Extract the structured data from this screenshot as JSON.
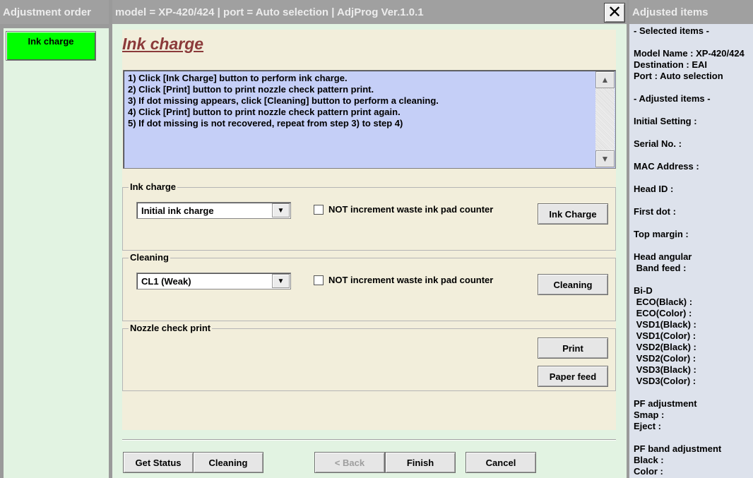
{
  "left_pane": {
    "title": "Adjustment order",
    "items": [
      {
        "label": "Ink charge",
        "active": true,
        "color": "#00ff00"
      }
    ]
  },
  "window": {
    "title": "model = XP-420/424  |  port = Auto selection  |  AdjProg Ver.1.0.1",
    "close_icon": "close-icon",
    "close_glyph": "✕"
  },
  "main": {
    "page_title": "Ink charge",
    "instructions": [
      "1) Click [Ink Charge] button to perform ink charge.",
      "2) Click [Print] button to print nozzle check pattern print.",
      "3) If dot missing appears, click [Cleaning] button to perform a cleaning.",
      "4) Click [Print] button to print nozzle check pattern print again.",
      "5) If dot missing is not recovered, repeat from step 3) to step 4)"
    ],
    "ink_charge": {
      "legend": "Ink charge",
      "dropdown_value": "Initial ink charge",
      "checkbox_label": "NOT increment waste ink pad counter",
      "checkbox_checked": false,
      "button": "Ink Charge"
    },
    "cleaning": {
      "legend": "Cleaning",
      "dropdown_value": "CL1 (Weak)",
      "checkbox_label": "NOT increment waste ink pad counter",
      "checkbox_checked": false,
      "button": "Cleaning"
    },
    "nozzle": {
      "legend": "Nozzle check print",
      "print_button": "Print",
      "paper_feed_button": "Paper feed"
    }
  },
  "bottom_bar": {
    "get_status": "Get Status",
    "cleaning": "Cleaning",
    "back": "< Back",
    "back_disabled": true,
    "finish": "Finish",
    "cancel": "Cancel"
  },
  "right_pane": {
    "title": "Adjusted items",
    "lines": [
      "- Selected items -",
      "",
      "Model Name : XP-420/424",
      "Destination : EAI",
      "Port : Auto selection",
      "",
      "- Adjusted items -",
      "",
      "Initial Setting :",
      "",
      "Serial No. :",
      "",
      "MAC Address :",
      "",
      "Head ID :",
      "",
      "First dot :",
      "",
      "Top margin :",
      "",
      "Head angular",
      " Band feed :",
      "",
      "Bi-D",
      " ECO(Black)  :",
      " ECO(Color)  :",
      " VSD1(Black) :",
      " VSD1(Color) :",
      " VSD2(Black) :",
      " VSD2(Color) :",
      " VSD3(Black) :",
      " VSD3(Color) :",
      "",
      "PF adjustment",
      "Smap :",
      "Eject :",
      "",
      "PF band adjustment",
      "Black :",
      "Color :"
    ]
  },
  "colors": {
    "pane_bg": "#e2f3e2",
    "content_bg": "#f2eedb",
    "instructions_bg": "#c5cff7",
    "title_bar": "#a0a0a0",
    "page_title": "#8b3a3a",
    "right_pane_bg": "#dde2ec"
  }
}
